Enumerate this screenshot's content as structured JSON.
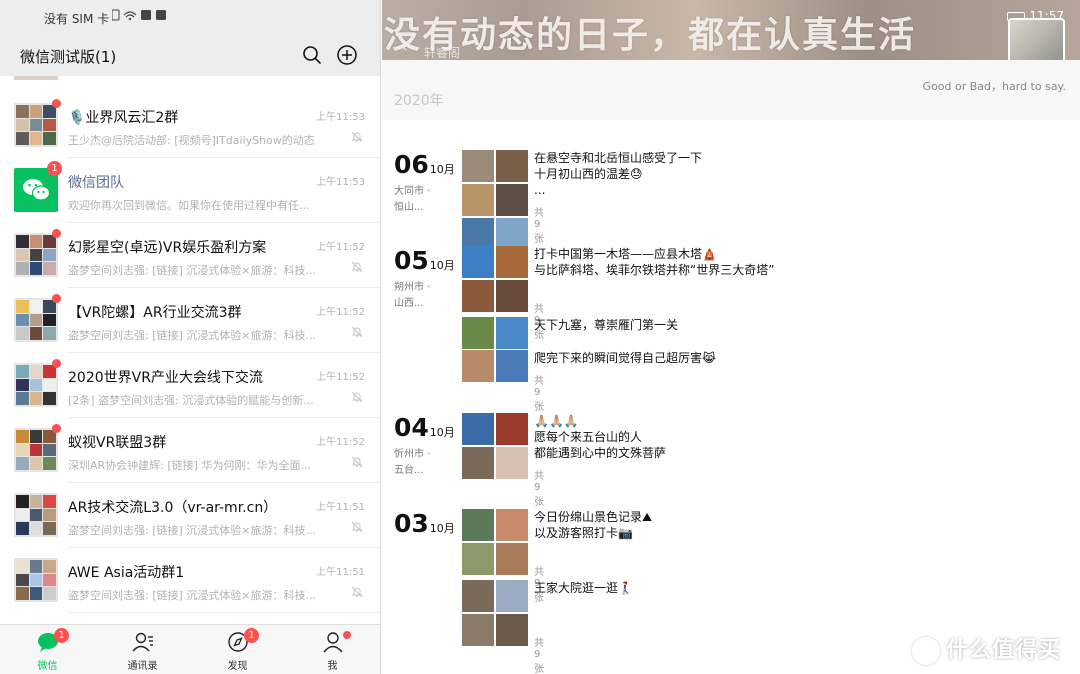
{
  "status_left": {
    "text": "没有 SIM 卡"
  },
  "status_right": {
    "time": "11:57"
  },
  "nav": {
    "title": "微信测试版(1)"
  },
  "chats": [
    {
      "name": "🎙️业界风云汇2群",
      "preview": "王少杰@后院活动部: [视频号]ITdailyShow的动态",
      "time": "上午11:53",
      "muted": true,
      "badge": ""
    },
    {
      "name": "微信团队",
      "preview": "欢迎你再次回到微信。如果你在使用过程中有任...",
      "time": "上午11:53",
      "muted": false,
      "badge": "1"
    },
    {
      "name": "幻影星空(卓远)VR娱乐盈利方案",
      "preview": "盗梦空间刘志强: [链接] 沉浸式体验×旅游：科技...",
      "time": "上午11:52",
      "muted": true,
      "badge": ""
    },
    {
      "name": "【VR陀螺】AR行业交流3群",
      "preview": "盗梦空间刘志强: [链接] 沉浸式体验×旅游：科技...",
      "time": "上午11:52",
      "muted": true,
      "badge": ""
    },
    {
      "name": "2020世界VR产业大会线下交流",
      "preview": "[2条] 盗梦空间刘志强: 沉浸式体验的赋能与创新...",
      "time": "上午11:52",
      "muted": true,
      "badge": ""
    },
    {
      "name": "蚁视VR联盟3群",
      "preview": "深圳AR协会钟建辉: [链接] 华为何刚：华为全面...",
      "time": "上午11:52",
      "muted": true,
      "badge": ""
    },
    {
      "name": "AR技术交流L3.0（vr-ar-mr.cn）",
      "preview": "盗梦空间刘志强: [链接] 沉浸式体验×旅游：科技...",
      "time": "上午11:51",
      "muted": true,
      "badge": ""
    },
    {
      "name": "AWE Asia活动群1",
      "preview": "盗梦空间刘志强: [链接] 沉浸式体验×旅游：科技...",
      "time": "上午11:51",
      "muted": true,
      "badge": ""
    }
  ],
  "tabs": [
    {
      "label": "微信",
      "badge": "1",
      "active": true,
      "icon": "chat-icon"
    },
    {
      "label": "通讯录",
      "badge": "",
      "active": false,
      "icon": "contacts-icon"
    },
    {
      "label": "发现",
      "badge": "1",
      "active": false,
      "icon": "compass-icon"
    },
    {
      "label": "我",
      "badge": "dot",
      "active": false,
      "icon": "person-icon"
    }
  ],
  "profile": {
    "cover_text": "没有动态的日子，都在认真生活",
    "name": "轩睿阁",
    "signature": "Good or Bad，hard to say.",
    "year": "2020年"
  },
  "moments": [
    {
      "day": "06",
      "month": "10月",
      "loc1": "大同市 ·",
      "loc2": "恒山...",
      "posts": [
        {
          "lines": [
            "在悬空寺和北岳恒山感受了一下",
            "十月初山西的温差😓",
            "..."
          ],
          "count": "共9张"
        }
      ]
    },
    {
      "day": "05",
      "month": "10月",
      "loc1": "朔州市 ·",
      "loc2": "山西...",
      "posts": [
        {
          "lines": [
            "打卡中国第一木塔——应县木塔🛕",
            "与比萨斜塔、埃菲尔铁塔并称“世界三大奇塔”"
          ],
          "count": "共9张"
        },
        {
          "lines": [
            "天下九塞，尊崇雁门第一关"
          ],
          "count": ""
        },
        {
          "lines": [
            "爬完下来的瞬间觉得自己超厉害😹"
          ],
          "count": "共9张"
        }
      ]
    },
    {
      "day": "04",
      "month": "10月",
      "loc1": "忻州市 ·",
      "loc2": "五台...",
      "posts": [
        {
          "lines": [
            "🙏🏼🙏🏼🙏🏼",
            "愿每个来五台山的人",
            "都能遇到心中的文殊菩萨"
          ],
          "count": "共9张"
        }
      ]
    },
    {
      "day": "03",
      "month": "10月",
      "loc1": "",
      "loc2": "",
      "posts": [
        {
          "lines": [
            "今日份绵山景色记录⛰",
            "以及游客照打卡📷"
          ],
          "count": "共9张"
        },
        {
          "lines": [
            "王家大院逛一逛🚶‍♀️"
          ],
          "count": "共9张"
        }
      ]
    }
  ],
  "watermark": "什么值得买",
  "colors": {
    "wechat_green": "#07c160",
    "badge_red": "#fa5151",
    "link_blue": "#576b95"
  }
}
